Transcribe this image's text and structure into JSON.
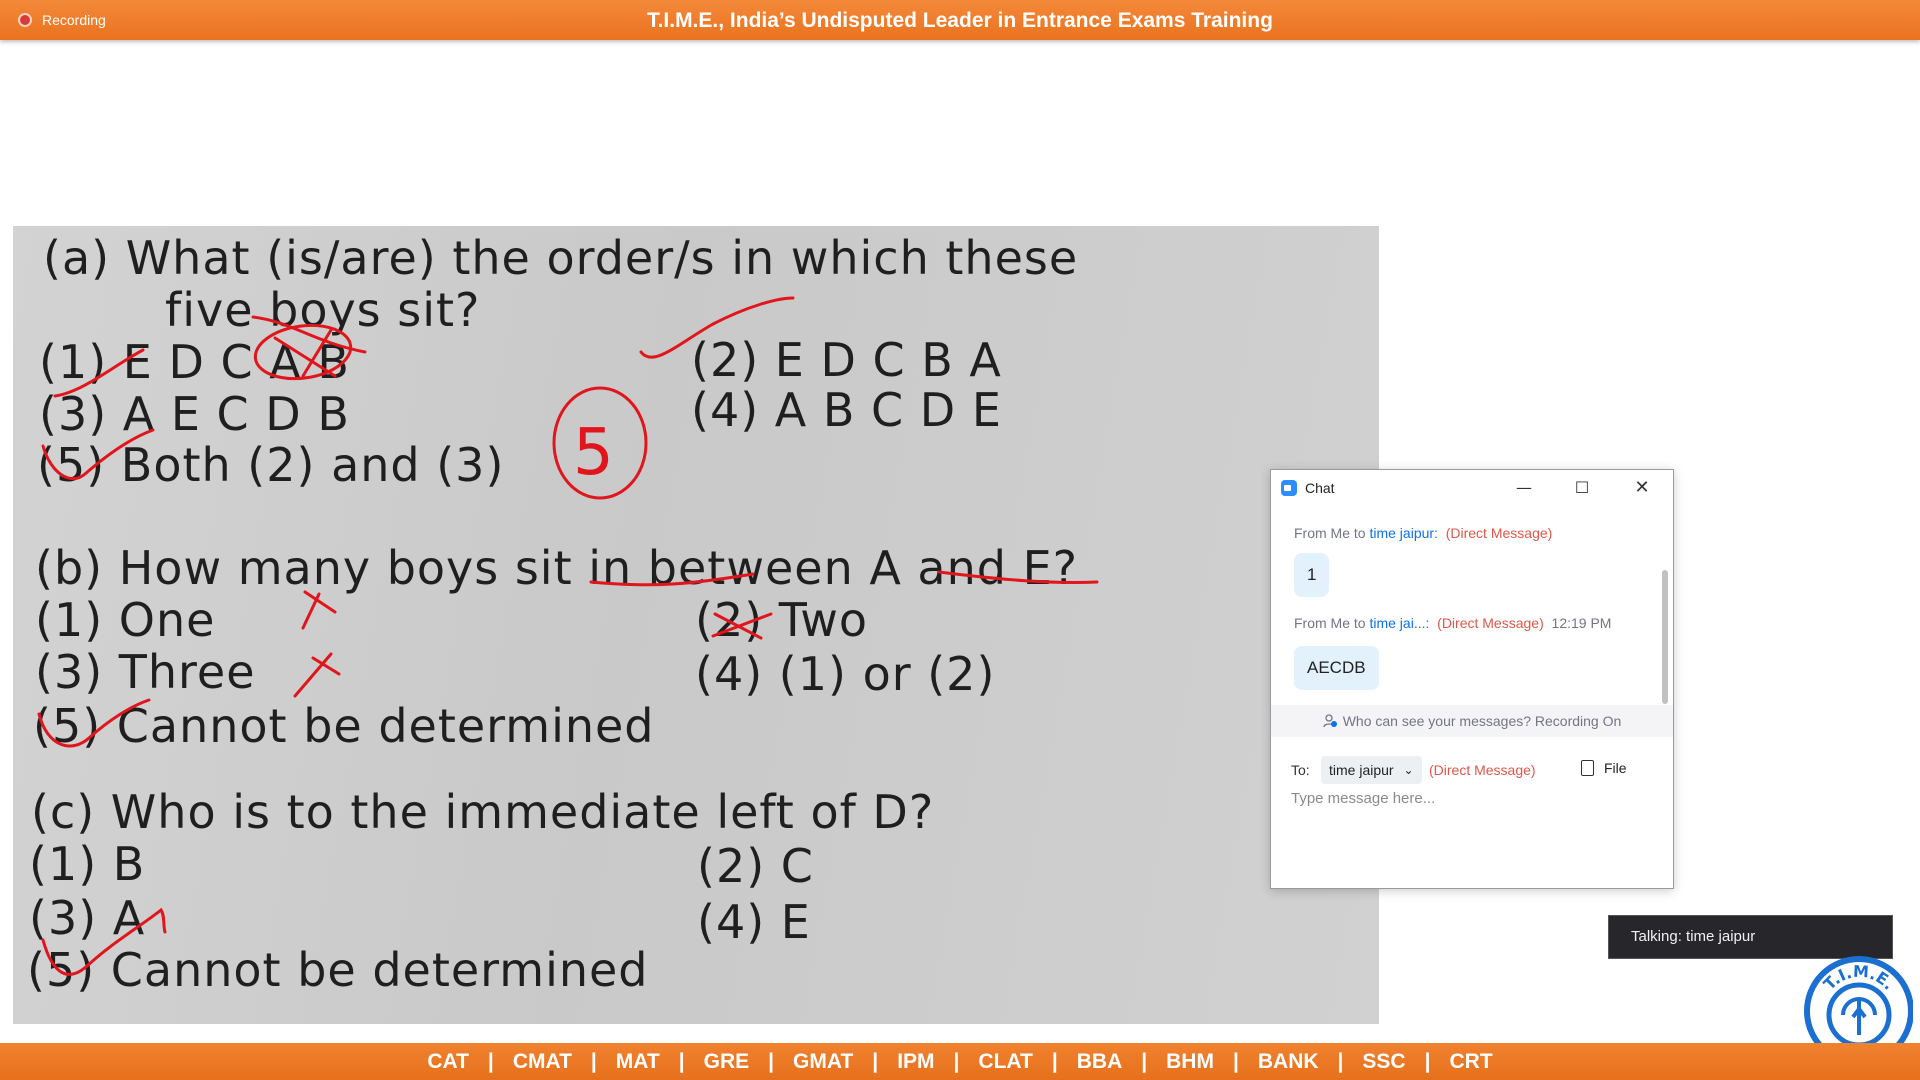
{
  "top_bar": {
    "recording_label": "Recording",
    "title": "T.I.M.E., India’s Undisputed Leader in Entrance Exams Training"
  },
  "worksheet": {
    "lines": [
      "(a)  What   (is/are)   the   order/s   in   which   these",
      "five boys sit?",
      "(1)  E D C A B",
      "(2)  E D C B A",
      "(3)  A E C D B",
      "(4)  A B C D E",
      "(5)  Both (2) and (3)",
      "(b)  How many boys sit in between A and E?",
      "(1)  One",
      "(2)  Two",
      "(3)  Three",
      "(4)  (1) or (2)",
      "(5)  Cannot be determined",
      "(c)  Who is to the immediate left of D?",
      "(1)  B",
      "(2)  C",
      "(3)  A",
      "(4)  E",
      "(5)  Cannot be determined"
    ],
    "handwritten_answer": "5"
  },
  "chat": {
    "title": "Chat",
    "messages": [
      {
        "from": "From Me to ",
        "recipient": "time jaipur:",
        "tag": "(Direct Message)",
        "time": "",
        "text": "1"
      },
      {
        "from": "From Me to ",
        "recipient": "time jai...:",
        "tag": "(Direct Message)",
        "time": "12:19 PM",
        "text": "AECDB"
      }
    ],
    "privacy_notice": "Who can see your messages? Recording On",
    "to_label": "To:",
    "recipient_select": "time jaipur",
    "recipient_tag": "(Direct Message)",
    "file_label": "File",
    "input_placeholder": "Type message here..."
  },
  "talking_indicator": "Talking: time jaipur",
  "logo_text": "T.I.M.E.",
  "bottom_bar": {
    "exams": [
      "CAT",
      "CMAT",
      "MAT",
      "GRE",
      "GMAT",
      "IPM",
      "CLAT",
      "BBA",
      "BHM",
      "BANK",
      "SSC",
      "CRT"
    ],
    "separator": "|"
  },
  "colors": {
    "banner_orange": "#ee7d2b",
    "chat_blue": "#0e72ed",
    "chat_red": "#e0574a",
    "bubble": "#e3f1fd",
    "ink_red": "#e0161c"
  }
}
